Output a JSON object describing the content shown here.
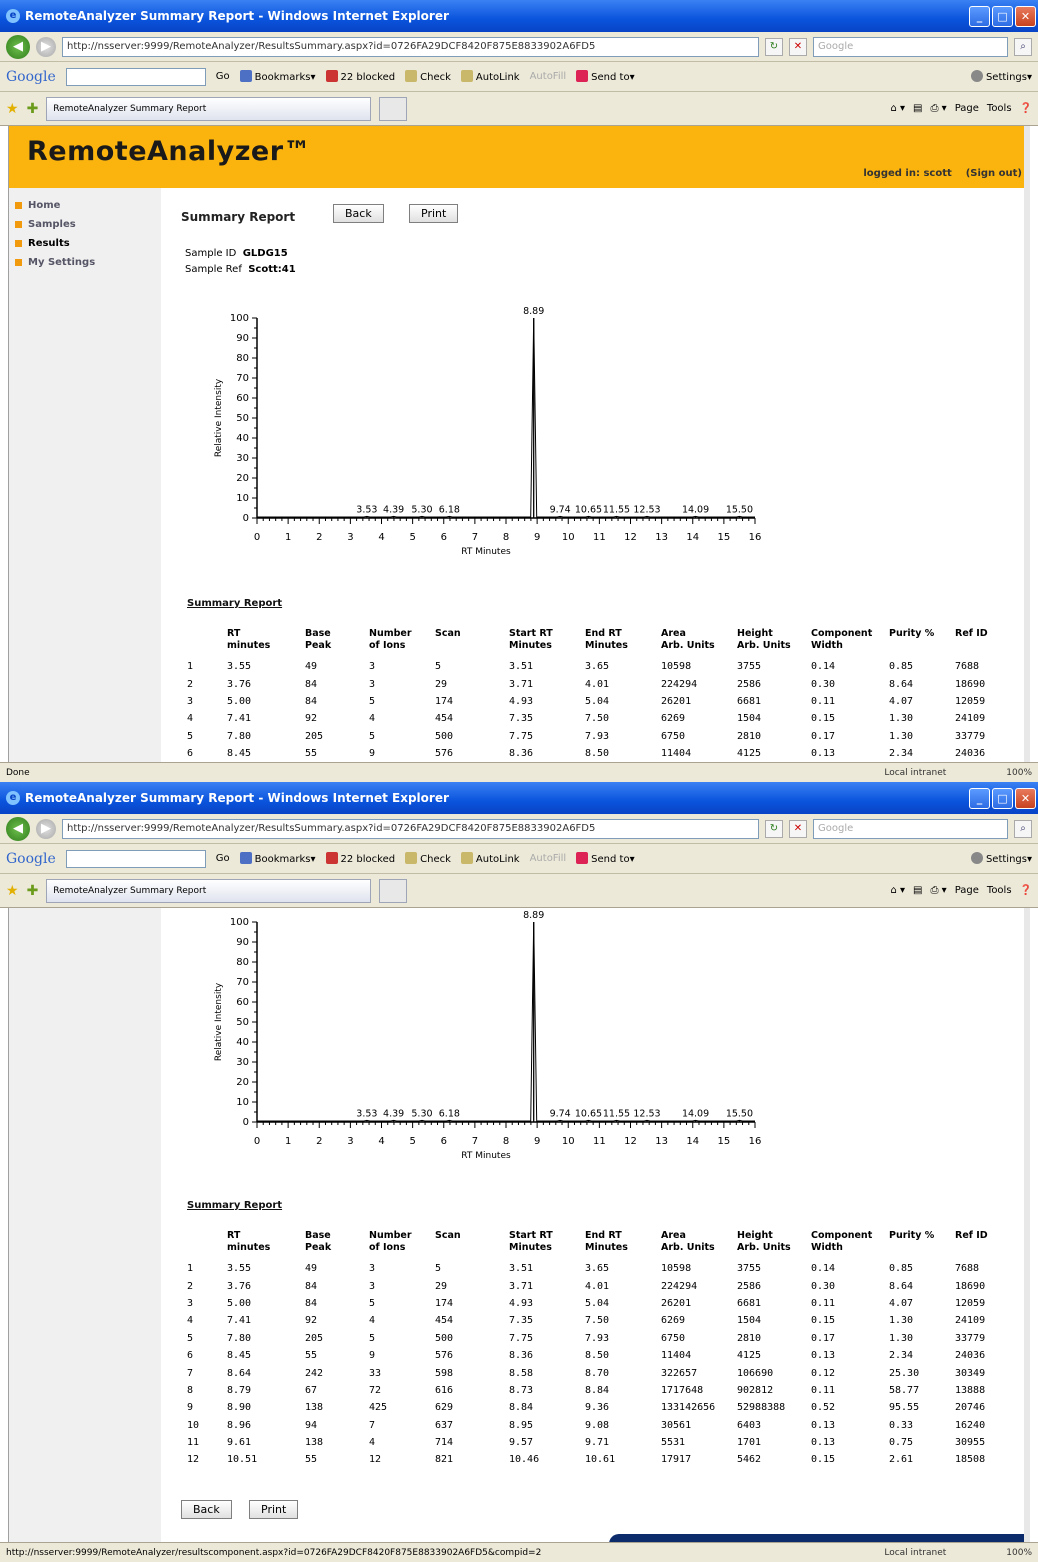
{
  "window": {
    "title": "RemoteAnalyzer Summary Report - Windows Internet Explorer",
    "url": "http://nsserver:9999/RemoteAnalyzer/ResultsSummary.aspx?id=0726FA29DCF8420F875E8833902A6FD5",
    "search_placeholder": "Google",
    "tab_label": "RemoteAnalyzer Summary Report"
  },
  "google_bar": {
    "logo": "Google",
    "go": "Go",
    "bookmarks": "Bookmarks▾",
    "blocked": "22 blocked",
    "check": "Check",
    "autolink": "AutoLink",
    "autofill": "AutoFill",
    "sendto": "Send to▾",
    "settings": "Settings▾"
  },
  "command_bar": {
    "page": "Page",
    "tools": "Tools"
  },
  "app": {
    "brand": "RemoteAnalyzer™",
    "login_text": "logged in: scott",
    "sign_out": "(Sign out)",
    "nav": [
      "Home",
      "Samples",
      "Results",
      "My Settings"
    ],
    "page_title": "Summary Report",
    "back": "Back",
    "print": "Print",
    "sample_id_label": "Sample ID",
    "sample_id": "GLDG15",
    "sample_ref_label": "Sample Ref",
    "sample_ref": "Scott:41",
    "table_title": "Summary Report"
  },
  "status": {
    "top_left": "Done",
    "bottom_left": "http://nsserver:9999/RemoteAnalyzer/resultscomponent.aspx?id=0726FA29DCF8420F875E8833902A6FD5&compid=2",
    "zone": "Local intranet",
    "zoom": "100%"
  },
  "chart_data": {
    "type": "line",
    "xlabel": "RT Minutes",
    "ylabel": "Relative Intensity",
    "xlim": [
      0,
      16
    ],
    "ylim": [
      0,
      100
    ],
    "x_ticks": [
      "0",
      "1",
      "2",
      "3",
      "4",
      "5",
      "6",
      "7",
      "8",
      "9",
      "10",
      "11",
      "12",
      "13",
      "14",
      "15",
      "16"
    ],
    "y_ticks": [
      "0",
      "10",
      "20",
      "30",
      "40",
      "50",
      "60",
      "70",
      "80",
      "90",
      "100"
    ],
    "peaks": [
      {
        "x": 3.53,
        "label": "3.53",
        "y": 0.8
      },
      {
        "x": 4.39,
        "label": "4.39",
        "y": 0.8
      },
      {
        "x": 5.3,
        "label": "5.30",
        "y": 0.8
      },
      {
        "x": 6.18,
        "label": "6.18",
        "y": 0.8
      },
      {
        "x": 8.89,
        "label": "8.89",
        "y": 100
      },
      {
        "x": 9.74,
        "label": "9.74",
        "y": 0.8
      },
      {
        "x": 10.65,
        "label": "10.65",
        "y": 0.8
      },
      {
        "x": 11.55,
        "label": "11.55",
        "y": 0.8
      },
      {
        "x": 12.53,
        "label": "12.53",
        "y": 0.8
      },
      {
        "x": 14.09,
        "label": "14.09",
        "y": 0.8
      },
      {
        "x": 15.5,
        "label": "15.50",
        "y": 0.8
      }
    ]
  },
  "table": {
    "headers": [
      [
        "",
        ""
      ],
      [
        "RT",
        "minutes"
      ],
      [
        "Base",
        "Peak"
      ],
      [
        "Number",
        "of Ions"
      ],
      [
        "Scan",
        ""
      ],
      [
        "Start RT",
        "Minutes"
      ],
      [
        "End RT",
        "Minutes"
      ],
      [
        "Area",
        "Arb. Units"
      ],
      [
        "Height",
        "Arb. Units"
      ],
      [
        "Component",
        "Width"
      ],
      [
        "Purity %",
        ""
      ],
      [
        "Ref ID",
        ""
      ]
    ],
    "rows": [
      [
        "1",
        "3.55",
        "49",
        "3",
        "5",
        "3.51",
        "3.65",
        "10598",
        "3755",
        "0.14",
        "0.85",
        "7688"
      ],
      [
        "2",
        "3.76",
        "84",
        "3",
        "29",
        "3.71",
        "4.01",
        "224294",
        "2586",
        "0.30",
        "8.64",
        "18690"
      ],
      [
        "3",
        "5.00",
        "84",
        "5",
        "174",
        "4.93",
        "5.04",
        "26201",
        "6681",
        "0.11",
        "4.07",
        "12059"
      ],
      [
        "4",
        "7.41",
        "92",
        "4",
        "454",
        "7.35",
        "7.50",
        "6269",
        "1504",
        "0.15",
        "1.30",
        "24109"
      ],
      [
        "5",
        "7.80",
        "205",
        "5",
        "500",
        "7.75",
        "7.93",
        "6750",
        "2810",
        "0.17",
        "1.30",
        "33779"
      ],
      [
        "6",
        "8.45",
        "55",
        "9",
        "576",
        "8.36",
        "8.50",
        "11404",
        "4125",
        "0.13",
        "2.34",
        "24036"
      ],
      [
        "7",
        "8.64",
        "242",
        "33",
        "598",
        "8.58",
        "8.70",
        "322657",
        "106690",
        "0.12",
        "25.30",
        "30349"
      ],
      [
        "8",
        "8.79",
        "67",
        "72",
        "616",
        "8.73",
        "8.84",
        "1717648",
        "902812",
        "0.11",
        "58.77",
        "13888"
      ],
      [
        "9",
        "8.90",
        "138",
        "425",
        "629",
        "8.84",
        "9.36",
        "133142656",
        "52988388",
        "0.52",
        "95.55",
        "20746"
      ],
      [
        "10",
        "8.96",
        "94",
        "7",
        "637",
        "8.95",
        "9.08",
        "30561",
        "6403",
        "0.13",
        "0.33",
        "16240"
      ],
      [
        "11",
        "9.61",
        "138",
        "4",
        "714",
        "9.57",
        "9.71",
        "5531",
        "1701",
        "0.13",
        "0.75",
        "30955"
      ],
      [
        "12",
        "10.51",
        "55",
        "12",
        "821",
        "10.46",
        "10.61",
        "17917",
        "5462",
        "0.15",
        "2.61",
        "18508"
      ]
    ]
  }
}
